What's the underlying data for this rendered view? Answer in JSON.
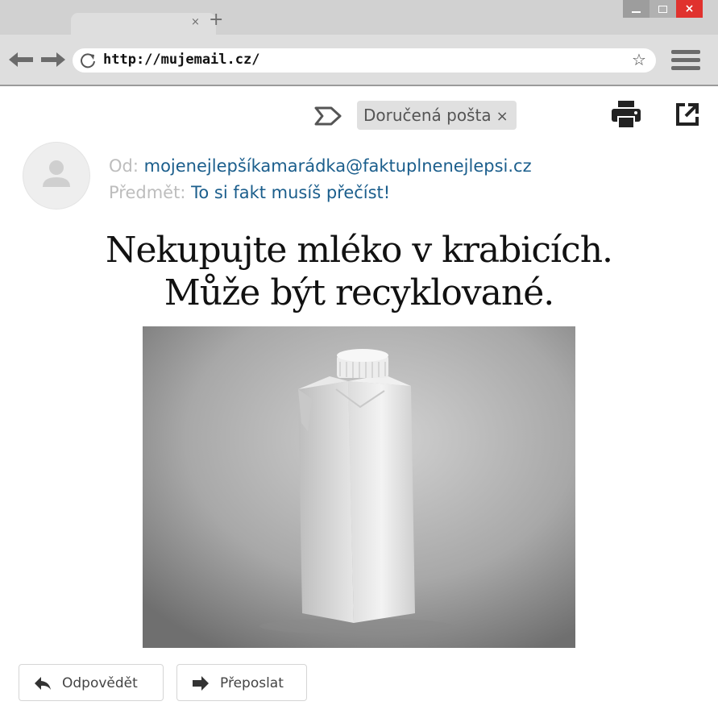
{
  "browser": {
    "tab": {
      "close_glyph": "×",
      "new_tab_glyph": "+"
    },
    "window": {
      "close_glyph": "×"
    },
    "url": "http://mujemail.cz/",
    "star_glyph": "☆"
  },
  "email": {
    "label_chip": {
      "text": "Doručená pošta",
      "remove_glyph": "×"
    },
    "from_label": "Od:",
    "from_value": "mojenejlepšíkamarádka@faktuplnenejlepsi.cz",
    "subject_label": "Předmět:",
    "subject_value": "To si fakt musíš přečíst!",
    "headline_line1": "Nekupujte mléko v krabicích.",
    "headline_line2": "Může být recyklované."
  },
  "actions": {
    "reply": "Odpovědět",
    "forward": "Přeposlat"
  },
  "colors": {
    "link_blue": "#1b5e8c",
    "label_gray": "#bdbdbd",
    "close_red": "#e0322e",
    "chrome_gray": "#dedede"
  },
  "icons": [
    "back-arrow-icon",
    "forward-arrow-icon",
    "reload-icon",
    "star-icon",
    "hamburger-menu-icon",
    "label-icon",
    "print-icon",
    "open-in-new-icon",
    "avatar-person-icon",
    "reply-icon",
    "forward-icon"
  ]
}
